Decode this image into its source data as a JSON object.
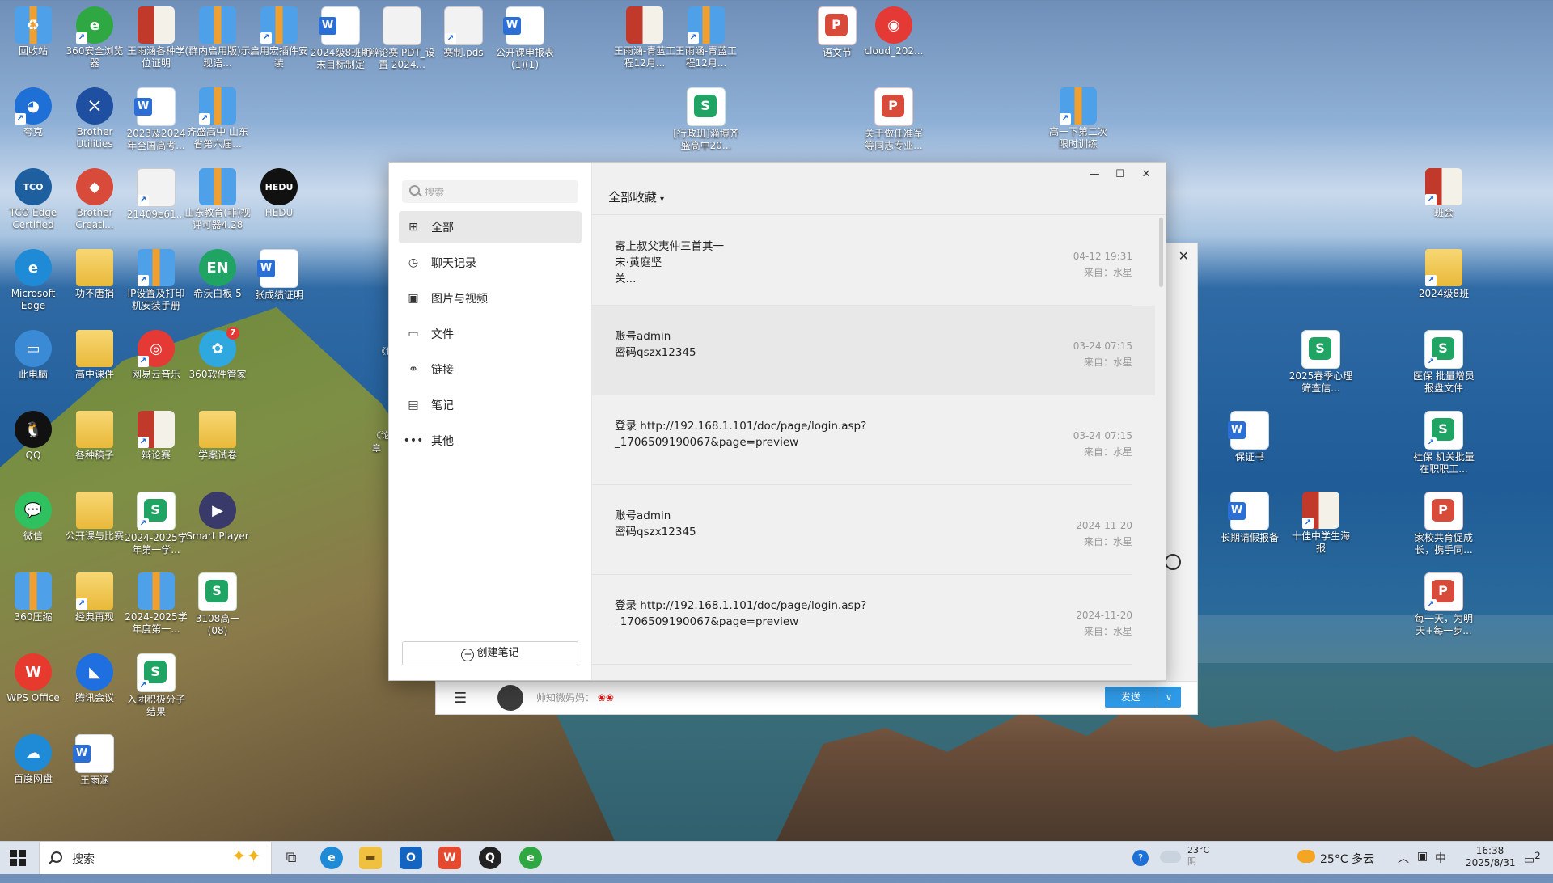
{
  "desktop": {
    "icons": [
      {
        "label": "回收站"
      },
      {
        "label": "360安全浏览器"
      },
      {
        "label": "王雨涵各种学位证明"
      },
      {
        "label": "(群内启用版)示现语..."
      },
      {
        "label": "启用宏插件安装"
      },
      {
        "label": "2024级8班期末目标制定"
      },
      {
        "label": "辩论赛 PDT_设置 2024..."
      },
      {
        "label": "赛制.pds"
      },
      {
        "label": "公开课申报表 (1)(1)"
      },
      {
        "label": "王雨涵-青蓝工程12月..."
      },
      {
        "label": "王雨涵-青蓝工程12月..."
      },
      {
        "label": "语文节"
      },
      {
        "label": "cloud_202..."
      },
      {
        "label": "夸克"
      },
      {
        "label": "Brother Utilities"
      },
      {
        "label": "2023及2024年全国高考..."
      },
      {
        "label": "齐盛高中 山东省第六届..."
      },
      {
        "label": "[行政班]淄博齐盛高中20..."
      },
      {
        "label": "关于做任准军等同志专业..."
      },
      {
        "label": "高一下第二次限时训练"
      },
      {
        "label": "TCO Edge Certified"
      },
      {
        "label": "Brother Creati..."
      },
      {
        "label": "21409e61..."
      },
      {
        "label": "山东教育(非)视评可器4.28"
      },
      {
        "label": "HEDU"
      },
      {
        "label": "班会"
      },
      {
        "label": "Microsoft Edge"
      },
      {
        "label": "功不唐捐"
      },
      {
        "label": "IP设置及打印机安装手册"
      },
      {
        "label": "希沃白板 5"
      },
      {
        "label": "张成绩证明"
      },
      {
        "label": "2024级8班"
      },
      {
        "label": "此电脑"
      },
      {
        "label": "高中课件"
      },
      {
        "label": "网易云音乐"
      },
      {
        "label": "360软件管家"
      },
      {
        "label": "2025春季心理筛查信..."
      },
      {
        "label": "医保 批量增员报盘文件"
      },
      {
        "label": "QQ"
      },
      {
        "label": "各种稿子"
      },
      {
        "label": "辩论赛"
      },
      {
        "label": "学案试卷"
      },
      {
        "label": "保证书"
      },
      {
        "label": "社保 机关批量在职职工..."
      },
      {
        "label": "微信"
      },
      {
        "label": "公开课与比赛"
      },
      {
        "label": "2024-2025学年第一学..."
      },
      {
        "label": "Smart Player"
      },
      {
        "label": "长期请假报备"
      },
      {
        "label": "十佳中学生海报"
      },
      {
        "label": "家校共育促成长，携手同..."
      },
      {
        "label": "360压缩"
      },
      {
        "label": "经典再现"
      },
      {
        "label": "2024-2025学年度第一..."
      },
      {
        "label": "3108高一 (08)"
      },
      {
        "label": "每一天，为明天+每一步..."
      },
      {
        "label": "WPS Office"
      },
      {
        "label": "腾讯会议"
      },
      {
        "label": "入团积极分子结果"
      },
      {
        "label": "百度网盘"
      },
      {
        "label": "王雨涵"
      }
    ],
    "badge_360": "7",
    "stray_left": "《论",
    "stray_left2": "《论章"
  },
  "back_window": {
    "contact_preview": "帅知微妈妈：",
    "send_label": "发送",
    "send_dropdown": "∨"
  },
  "favorites": {
    "search_placeholder": "搜索",
    "nav": [
      {
        "label": "全部",
        "icon": "grid-icon",
        "glyph": "⊞"
      },
      {
        "label": "聊天记录",
        "icon": "history-icon",
        "glyph": "◷"
      },
      {
        "label": "图片与视频",
        "icon": "image-icon",
        "glyph": "▣"
      },
      {
        "label": "文件",
        "icon": "folder-icon",
        "glyph": "▭"
      },
      {
        "label": "链接",
        "icon": "link-icon",
        "glyph": "⚭"
      },
      {
        "label": "笔记",
        "icon": "note-icon",
        "glyph": "▤"
      },
      {
        "label": "其他",
        "icon": "more-icon",
        "glyph": "•••"
      }
    ],
    "create_label": "创建笔记",
    "title": "全部收藏",
    "items": [
      {
        "text": "寄上叔父夷仲三首其一\n宋·黄庭坚\n关...",
        "date": "04-12 19:31",
        "source": "来自：水星"
      },
      {
        "text": "账号admin\n密码qszx12345",
        "date": "03-24 07:15",
        "source": "来自：水星"
      },
      {
        "text": "登录 http://192.168.1.101/doc/page/login.asp?\n_1706509190067&page=preview",
        "date": "03-24 07:15",
        "source": "来自：水星"
      },
      {
        "text": "账号admin\n密码qszx12345",
        "date": "2024-11-20",
        "source": "来自：水星"
      },
      {
        "text": "登录 http://192.168.1.101/doc/page/login.asp?\n_1706509190067&page=preview",
        "date": "2024-11-20",
        "source": "来自：水星"
      }
    ]
  },
  "taskbar": {
    "search_label": "搜索",
    "weather_temp": "23°C",
    "weather_state": "阴",
    "weather2": "25°C 多云",
    "ime": "中",
    "time": "16:38",
    "date": "2025/8/31",
    "notif_count": "2"
  }
}
